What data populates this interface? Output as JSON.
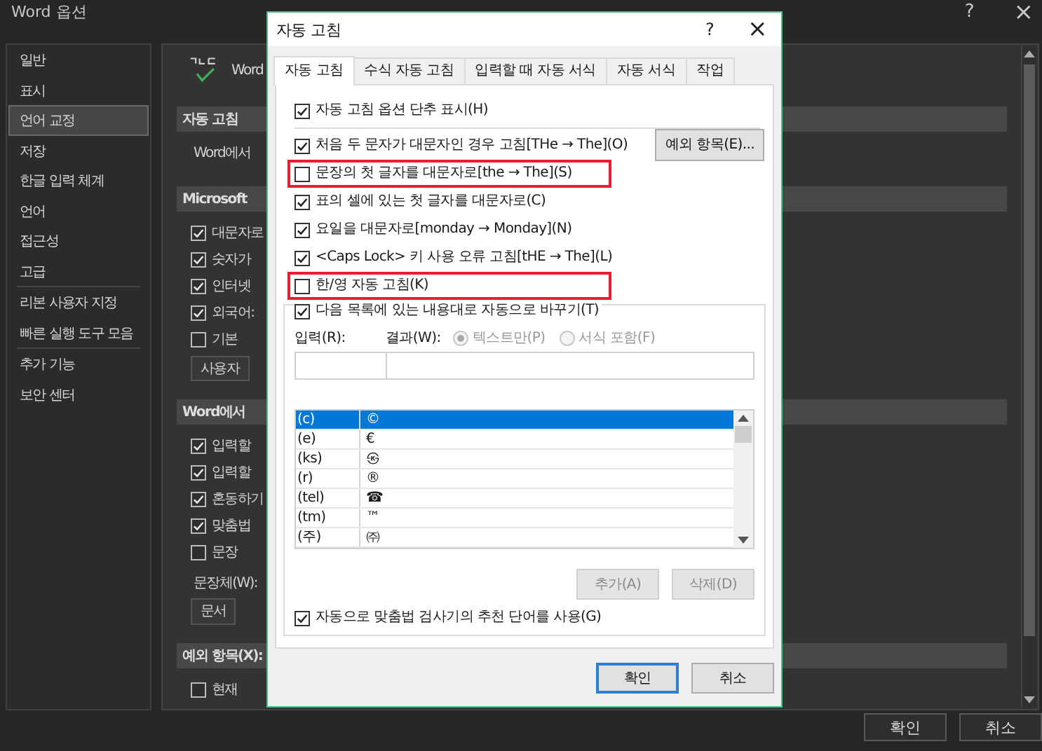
{
  "window": {
    "title": "Word 옵션",
    "help": "?",
    "close": "×"
  },
  "sidebar": {
    "groups": [
      {
        "items": [
          {
            "label": "일반",
            "selected": false
          },
          {
            "label": "표시",
            "selected": false
          },
          {
            "label": "언어 교정",
            "selected": true
          },
          {
            "label": "저장",
            "selected": false
          },
          {
            "label": "한글 입력 체계",
            "selected": false
          },
          {
            "label": "언어",
            "selected": false
          },
          {
            "label": "접근성",
            "selected": false
          },
          {
            "label": "고급",
            "selected": false
          }
        ]
      },
      {
        "items": [
          {
            "label": "리본 사용자 지정",
            "selected": false
          },
          {
            "label": "빠른 실행 도구 모음",
            "selected": false
          }
        ]
      },
      {
        "items": [
          {
            "label": "추가 기능",
            "selected": false
          },
          {
            "label": "보안 센터",
            "selected": false
          }
        ]
      }
    ]
  },
  "main": {
    "items": [
      {
        "kind": "header",
        "text": "Word"
      },
      {
        "kind": "band",
        "text": "자동 고침"
      },
      {
        "kind": "text",
        "text": "Word에서"
      },
      {
        "kind": "band",
        "text": "Microsoft"
      },
      {
        "kind": "checkbox",
        "label": "대문자로",
        "checked": true
      },
      {
        "kind": "checkbox",
        "label": "숫자가",
        "checked": true
      },
      {
        "kind": "checkbox",
        "label": "인터넷",
        "checked": true
      },
      {
        "kind": "checkbox",
        "label": "외국어:",
        "checked": true
      },
      {
        "kind": "checkbox",
        "label": "기본",
        "checked": false
      },
      {
        "kind": "button",
        "label": "사용자"
      },
      {
        "kind": "band",
        "text": "Word에서"
      },
      {
        "kind": "checkbox",
        "label": "입력할",
        "checked": true
      },
      {
        "kind": "checkbox",
        "label": "입력할",
        "checked": true
      },
      {
        "kind": "checkbox",
        "label": "혼동하기",
        "checked": true
      },
      {
        "kind": "checkbox",
        "label": "맞춤법",
        "checked": true
      },
      {
        "kind": "checkbox",
        "label": "문장",
        "checked": false
      },
      {
        "kind": "label",
        "text": "문장체(W):"
      },
      {
        "kind": "dropdown",
        "value": "문서"
      },
      {
        "kind": "band",
        "text": "예외 항목(X):"
      },
      {
        "kind": "checkbox",
        "label": "현재",
        "checked": false
      }
    ]
  },
  "footer_buttons": [
    {
      "label": "확인"
    },
    {
      "label": "취소"
    }
  ],
  "dialog": {
    "title": "자동 고침",
    "help": "?",
    "close": "×",
    "tabs": [
      {
        "label": "자동 고침",
        "selected": true
      },
      {
        "label": "수식 자동 고침",
        "selected": false
      },
      {
        "label": "입력할 때 자동 서식",
        "selected": false
      },
      {
        "label": "자동 서식",
        "selected": false
      },
      {
        "label": "작업",
        "selected": false
      }
    ],
    "options": [
      {
        "label": "자동 고침 옵션 단추 표시(H)",
        "checked": true,
        "highlighted": false
      },
      {
        "label": "처음 두 문자가 대문자인 경우 고침[THe → The](O)",
        "checked": true,
        "highlighted": false
      },
      {
        "label": "문장의 첫 글자를 대문자로[the → The](S)",
        "checked": false,
        "highlighted": true
      },
      {
        "label": "표의 셀에 있는 첫 글자를 대문자로(C)",
        "checked": true,
        "highlighted": false
      },
      {
        "label": "요일을 대문자로[monday → Monday](N)",
        "checked": true,
        "highlighted": false
      },
      {
        "label": "<Caps Lock> 키 사용 오류 고침[tHE → The](L)",
        "checked": true,
        "highlighted": false
      },
      {
        "label": "한/영 자동 고침(K)",
        "checked": false,
        "highlighted": true
      }
    ],
    "exceptions_button": {
      "label": "예외 항목(E)..."
    },
    "replace": {
      "label": "다음 목록에 있는 내용대로 자동으로 바꾸기(T)",
      "checked": true
    },
    "input_label": "입력(R):",
    "result_label": "결과(W):",
    "radios": [
      {
        "label": "텍스트만(P)",
        "selected": true,
        "disabled": true
      },
      {
        "label": "서식 포함(F)",
        "selected": false,
        "disabled": true
      }
    ],
    "entries": [
      {
        "input": "(c)",
        "result": "©",
        "selected": true
      },
      {
        "input": "(e)",
        "result": "€",
        "selected": false
      },
      {
        "input": "(ks)",
        "result": "㉿",
        "selected": false
      },
      {
        "input": "(r)",
        "result": "®",
        "selected": false
      },
      {
        "input": "(tel)",
        "result": "☎",
        "selected": false
      },
      {
        "input": "(tm)",
        "result": "™",
        "selected": false
      },
      {
        "input": "(주)",
        "result": "㈜",
        "selected": false
      }
    ],
    "add_button": {
      "label": "추가(A)",
      "disabled": true
    },
    "delete_button": {
      "label": "삭제(D)",
      "disabled": true
    },
    "suggest": {
      "label": "자동으로 맞춤법 검사기의 추천 단어를 사용(G)",
      "checked": true
    },
    "buttons": [
      {
        "label": "확인",
        "default": true
      },
      {
        "label": "취소",
        "default": false
      }
    ]
  }
}
